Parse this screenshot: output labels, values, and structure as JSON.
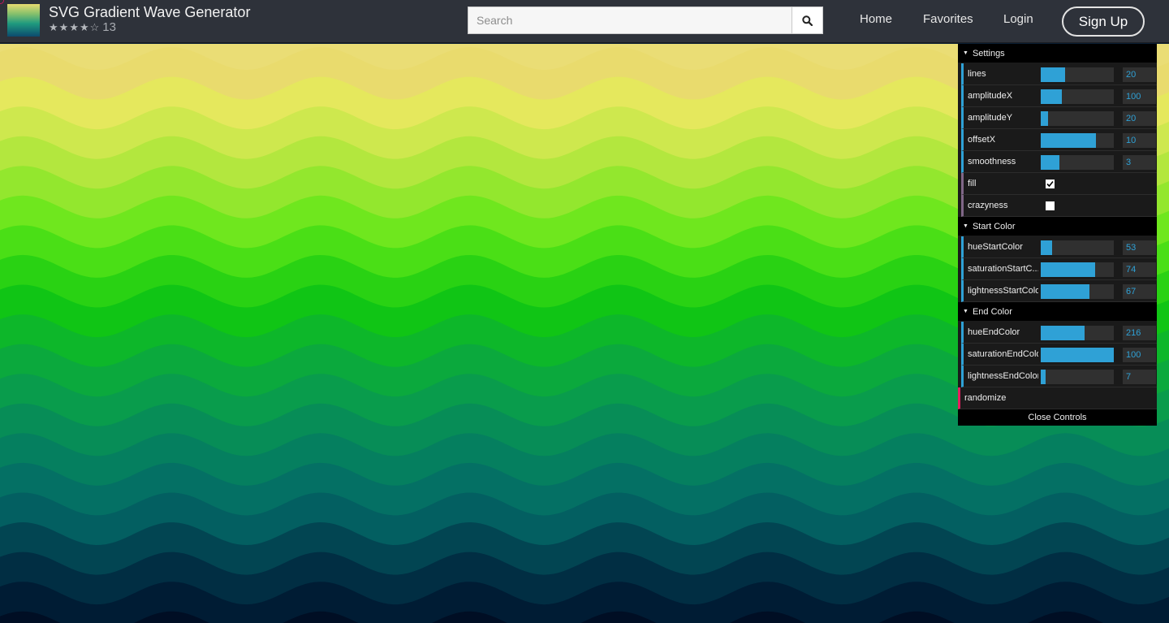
{
  "header": {
    "title": "SVG Gradient Wave Generator",
    "rating_stars": 4,
    "rating_count": "13",
    "search_placeholder": "Search",
    "nav": [
      "Home",
      "Favorites",
      "Login"
    ],
    "signup_label": "Sign Up"
  },
  "gui": {
    "settings": {
      "title": "Settings",
      "controls": [
        {
          "label": "lines",
          "value": "20",
          "fill": 0.33
        },
        {
          "label": "amplitudeX",
          "value": "100",
          "fill": 0.29
        },
        {
          "label": "amplitudeY",
          "value": "20",
          "fill": 0.1
        },
        {
          "label": "offsetX",
          "value": "10",
          "fill": 0.76
        },
        {
          "label": "smoothness",
          "value": "3",
          "fill": 0.26
        }
      ],
      "toggles": [
        {
          "label": "fill",
          "checked": true
        },
        {
          "label": "crazyness",
          "checked": false
        }
      ]
    },
    "start_color": {
      "title": "Start Color",
      "controls": [
        {
          "label": "hueStartColor",
          "value": "53",
          "fill": 0.15
        },
        {
          "label": "saturationStartC...",
          "value": "74",
          "fill": 0.74
        },
        {
          "label": "lightnessStartColo",
          "value": "67",
          "fill": 0.67
        }
      ]
    },
    "end_color": {
      "title": "End Color",
      "controls": [
        {
          "label": "hueEndColor",
          "value": "216",
          "fill": 0.6
        },
        {
          "label": "saturationEndColo",
          "value": "100",
          "fill": 1.0
        },
        {
          "label": "lightnessEndColor",
          "value": "7",
          "fill": 0.07
        }
      ]
    },
    "randomize_label": "randomize",
    "close_label": "Close Controls"
  },
  "colors": {
    "slider_accent": "#2fa1d6",
    "panel_bg": "#1a1a1a",
    "topbar_bg": "#2e323a"
  }
}
